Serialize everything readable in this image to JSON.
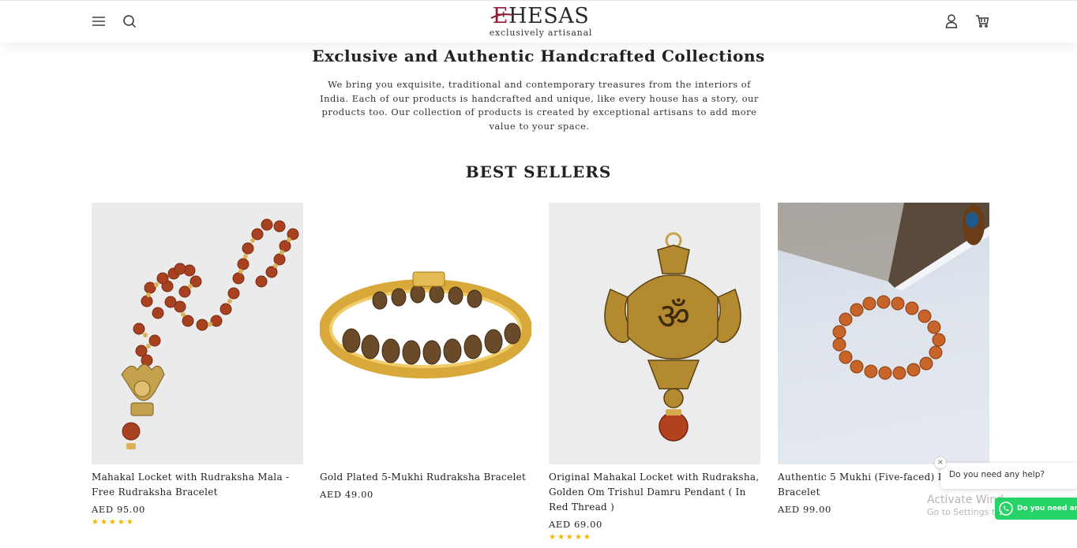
{
  "header": {
    "logo_main_prefix": "E",
    "logo_main_rest": "HESAS",
    "logo_tagline": "exclusively artisanal",
    "icons": [
      "menu-icon",
      "search-icon",
      "account-icon",
      "cart-icon"
    ]
  },
  "hero": {
    "headline": "Exclusive and Authentic Handcrafted Collections",
    "intro": "We bring you exquisite, traditional and contemporary treasures from the interiors of India. Each of our products is handcrafted and unique, like every house has a story, our products too. Our collection of products is created by exceptional artisans to add more value to your space."
  },
  "best_sellers": {
    "title": "BEST SELLERS",
    "products": [
      {
        "name": "Mahakal Locket with Rudraksha Mala - Free Rudraksha Bracelet",
        "price": "AED 95.00",
        "stars": "★★★★★"
      },
      {
        "name": "Gold Plated 5-Mukhi Rudraksha Bracelet",
        "price": "AED 49.00",
        "stars": ""
      },
      {
        "name": "Original Mahakal Locket with Rudraksha, Golden Om Trishul Damru Pendant ( In Red Thread )",
        "price": "AED 69.00",
        "stars": "★★★★★"
      },
      {
        "name": "Authentic 5 Mukhi (Five-faced) Rudra",
        "name_line2": "Bracelet",
        "price": "AED 99.00",
        "stars": ""
      }
    ]
  },
  "chat": {
    "close": "×",
    "bubble": "Do you need any help?",
    "whatsapp_label": "Do you need any h"
  },
  "watermark": {
    "line1": "Activate Wind",
    "line2": "Go to Settings to"
  },
  "colors": {
    "logo_accent": "#8c1c2f",
    "star": "#f5b400",
    "whatsapp": "#25d366"
  }
}
